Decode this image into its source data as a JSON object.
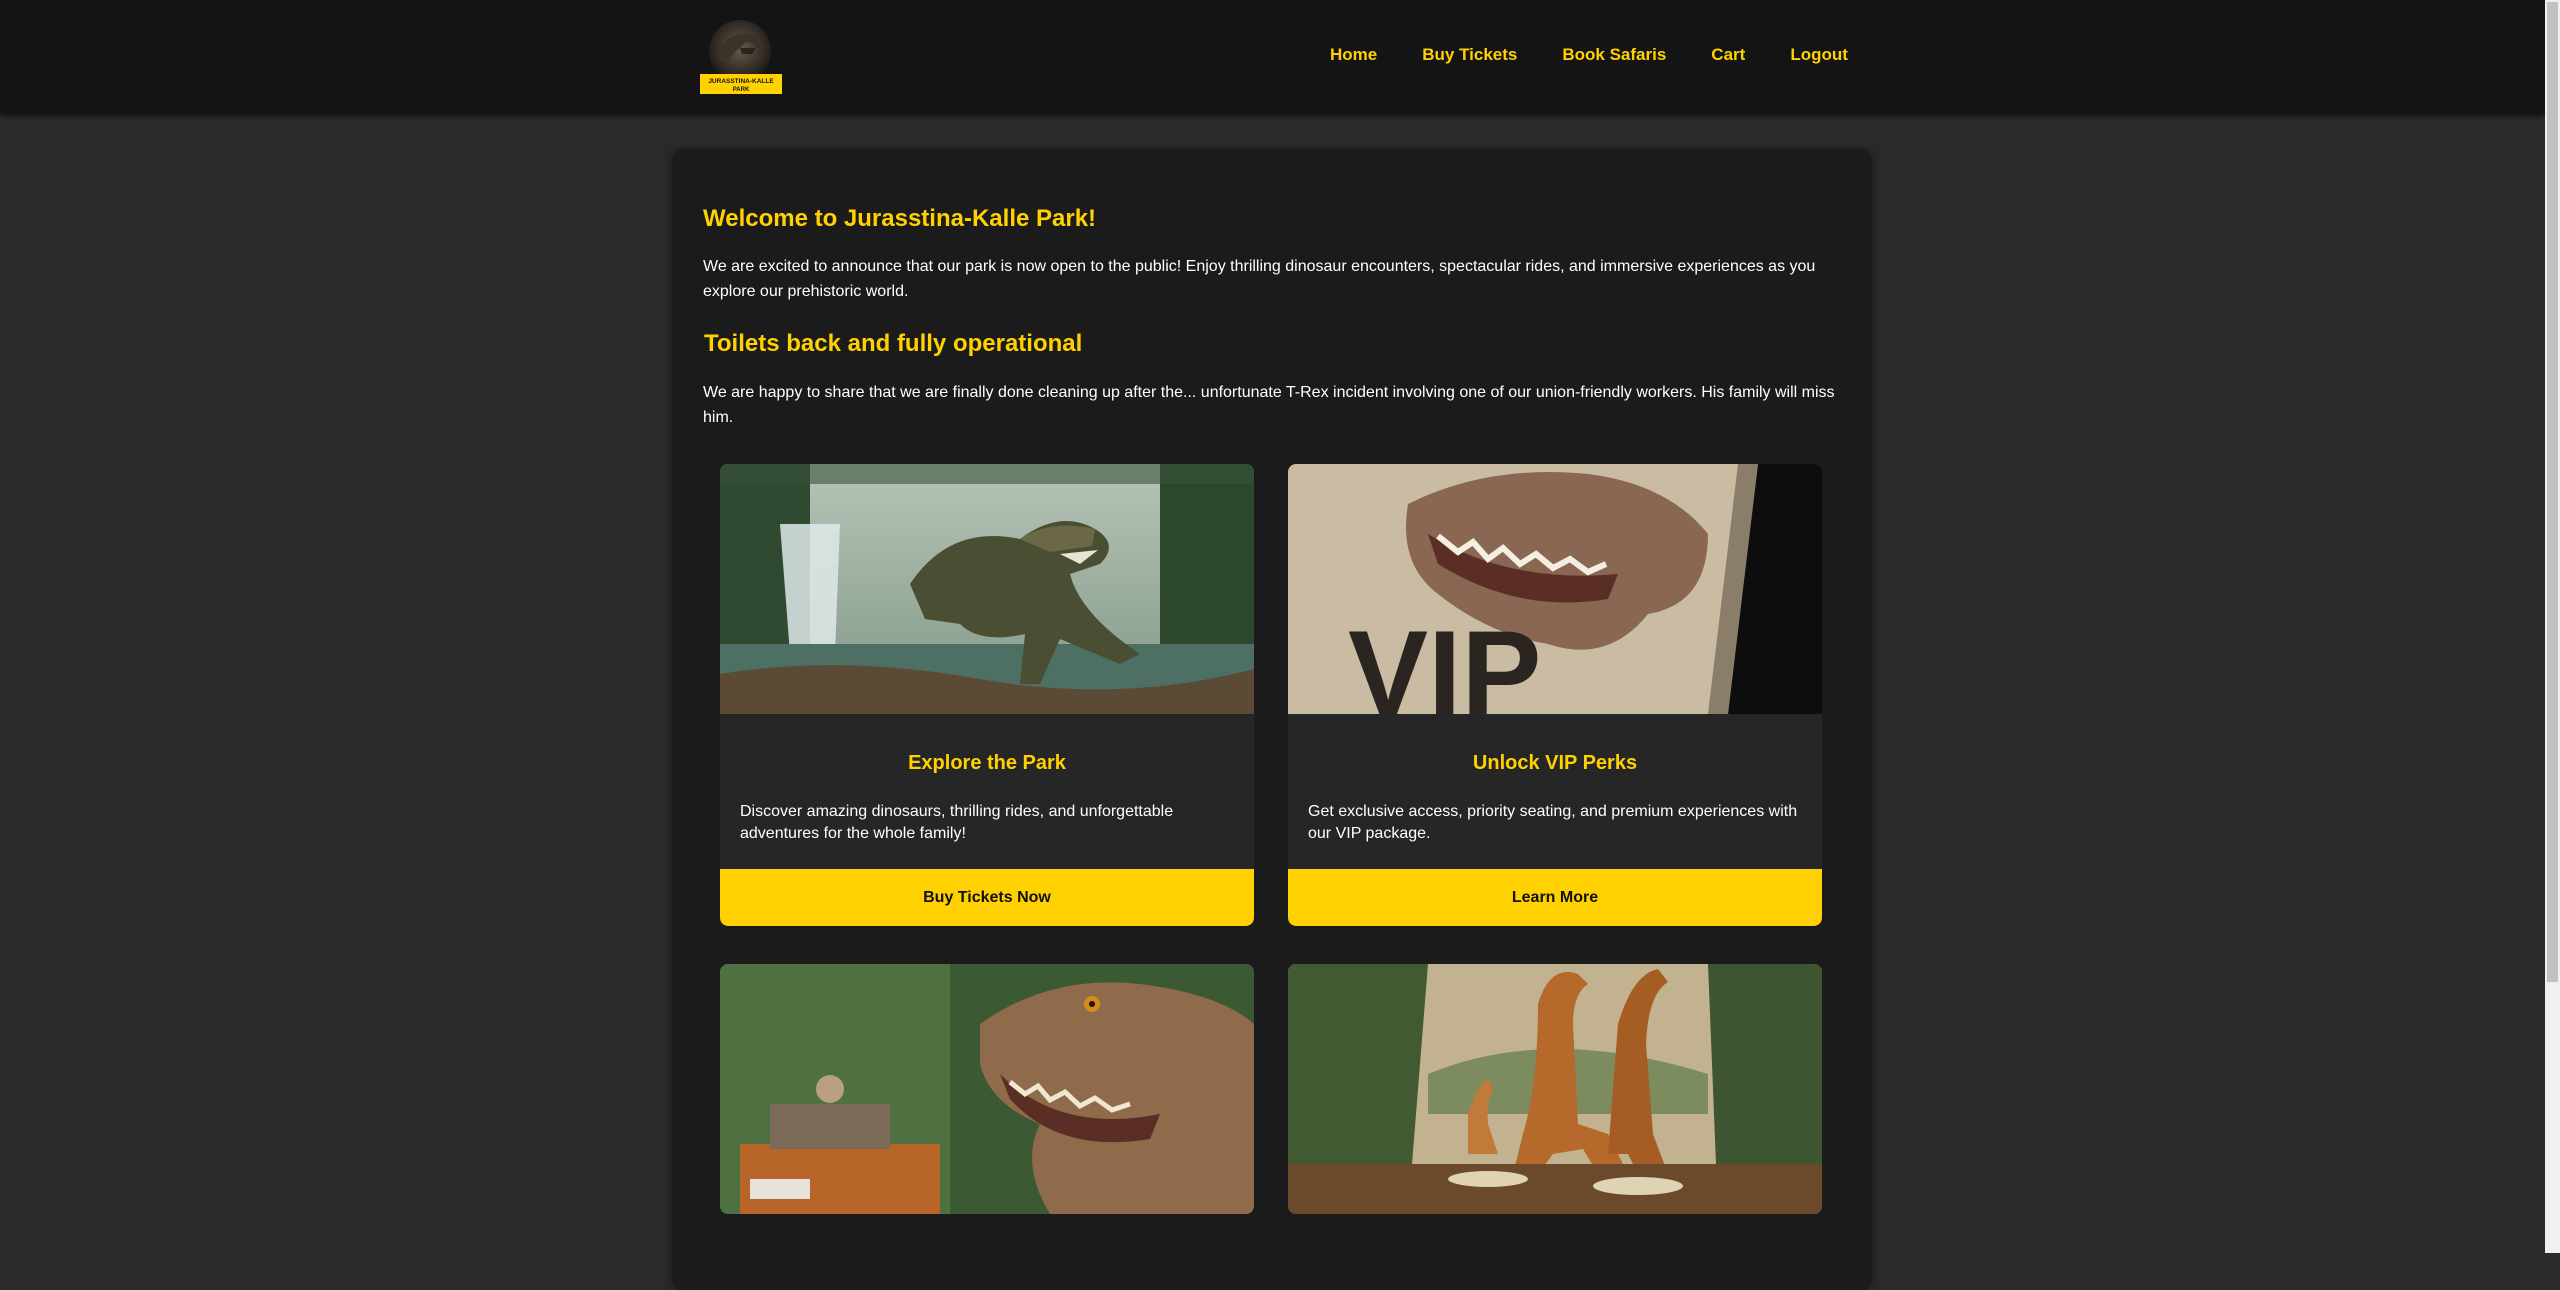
{
  "nav": {
    "logo_text_line1": "JURASSTINA-KALLE",
    "logo_text_line2": "PARK",
    "links": [
      "Home",
      "Buy Tickets",
      "Book Safaris",
      "Cart",
      "Logout"
    ]
  },
  "welcome": {
    "title": "Welcome to Jurasstina-Kalle Park!",
    "text": "We are excited to announce that our park is now open to the public! Enjoy thrilling dinosaur encounters, spectacular rides, and immersive experiences as you explore our prehistoric world."
  },
  "toilets": {
    "title": "Toilets back and fully operational",
    "text": "We are happy to share that we are finally done cleaning up after the... unfortunate T-Rex incident involving one of our union-friendly workers. His family will miss him."
  },
  "cards": [
    {
      "title": "Explore the Park",
      "text": "Discover amazing dinosaurs, thrilling rides, and unforgettable adventures for the whole family!",
      "button": "Buy Tickets Now",
      "image_icon": "t-rex-waterfall-image"
    },
    {
      "title": "Unlock VIP Perks",
      "text": "Get exclusive access, priority seating, and premium experiences with our VIP package.",
      "button": "Learn More",
      "image_icon": "vip-ticket-dinosaur-image",
      "image_text": "VIP"
    },
    {
      "image_icon": "safari-jeep-dinosaur-image"
    },
    {
      "image_icon": "brachiosaurus-dining-image"
    }
  ],
  "colors": {
    "accent": "#ffd100",
    "background": "#2b2b2b",
    "panel": "#1b1b1b",
    "navbar": "#141414"
  }
}
